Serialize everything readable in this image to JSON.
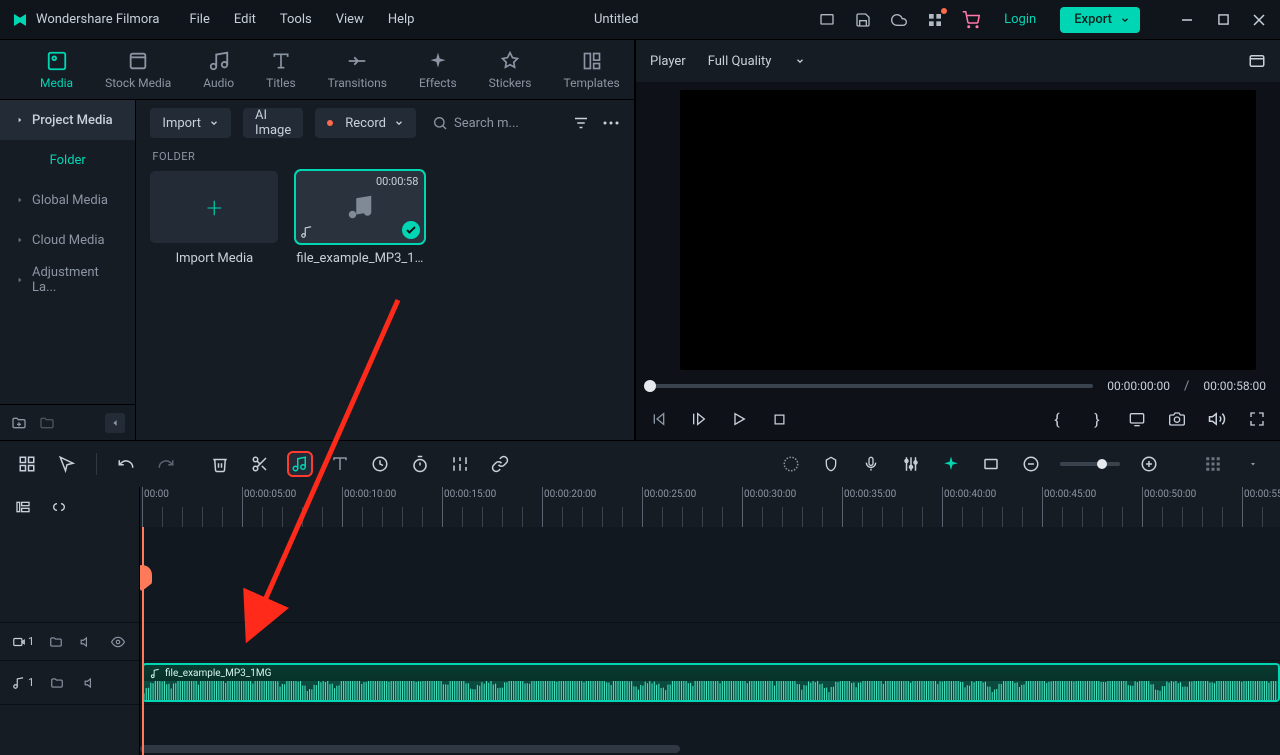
{
  "app_name": "Wondershare Filmora",
  "project_title": "Untitled",
  "menu": [
    "File",
    "Edit",
    "Tools",
    "View",
    "Help"
  ],
  "login_label": "Login",
  "export_label": "Export",
  "categories": [
    {
      "id": "media",
      "label": "Media",
      "active": true
    },
    {
      "id": "stock",
      "label": "Stock Media"
    },
    {
      "id": "audio",
      "label": "Audio"
    },
    {
      "id": "titles",
      "label": "Titles"
    },
    {
      "id": "transitions",
      "label": "Transitions"
    },
    {
      "id": "effects",
      "label": "Effects"
    },
    {
      "id": "stickers",
      "label": "Stickers"
    },
    {
      "id": "templates",
      "label": "Templates"
    }
  ],
  "sidebar": {
    "primary": "Project Media",
    "folder_label": "Folder",
    "items": [
      "Global Media",
      "Cloud Media",
      "Adjustment La..."
    ]
  },
  "media_toolbar": {
    "import": "Import",
    "ai_image": "AI Image",
    "record": "Record",
    "search_placeholder": "Search m..."
  },
  "folder_header": "FOLDER",
  "thumbs": {
    "import": "Import Media",
    "file": {
      "name": "file_example_MP3_1MG",
      "duration": "00:00:58"
    }
  },
  "player": {
    "tab": "Player",
    "quality": "Full Quality",
    "current": "00:00:00:00",
    "total": "00:00:58:00"
  },
  "timeline": {
    "ruler_labels": [
      "00:00",
      "00:00:05:00",
      "00:00:10:00",
      "00:00:15:00",
      "00:00:20:00",
      "00:00:25:00",
      "00:00:30:00",
      "00:00:35:00",
      "00:00:40:00",
      "00:00:45:00",
      "00:00:50:00",
      "00:00:55:0"
    ],
    "clip_name": "file_example_MP3_1MG",
    "video_track_idx": "1",
    "audio_track_idx": "1"
  },
  "colors": {
    "accent": "#00d6b4",
    "red": "#ff3b30"
  }
}
